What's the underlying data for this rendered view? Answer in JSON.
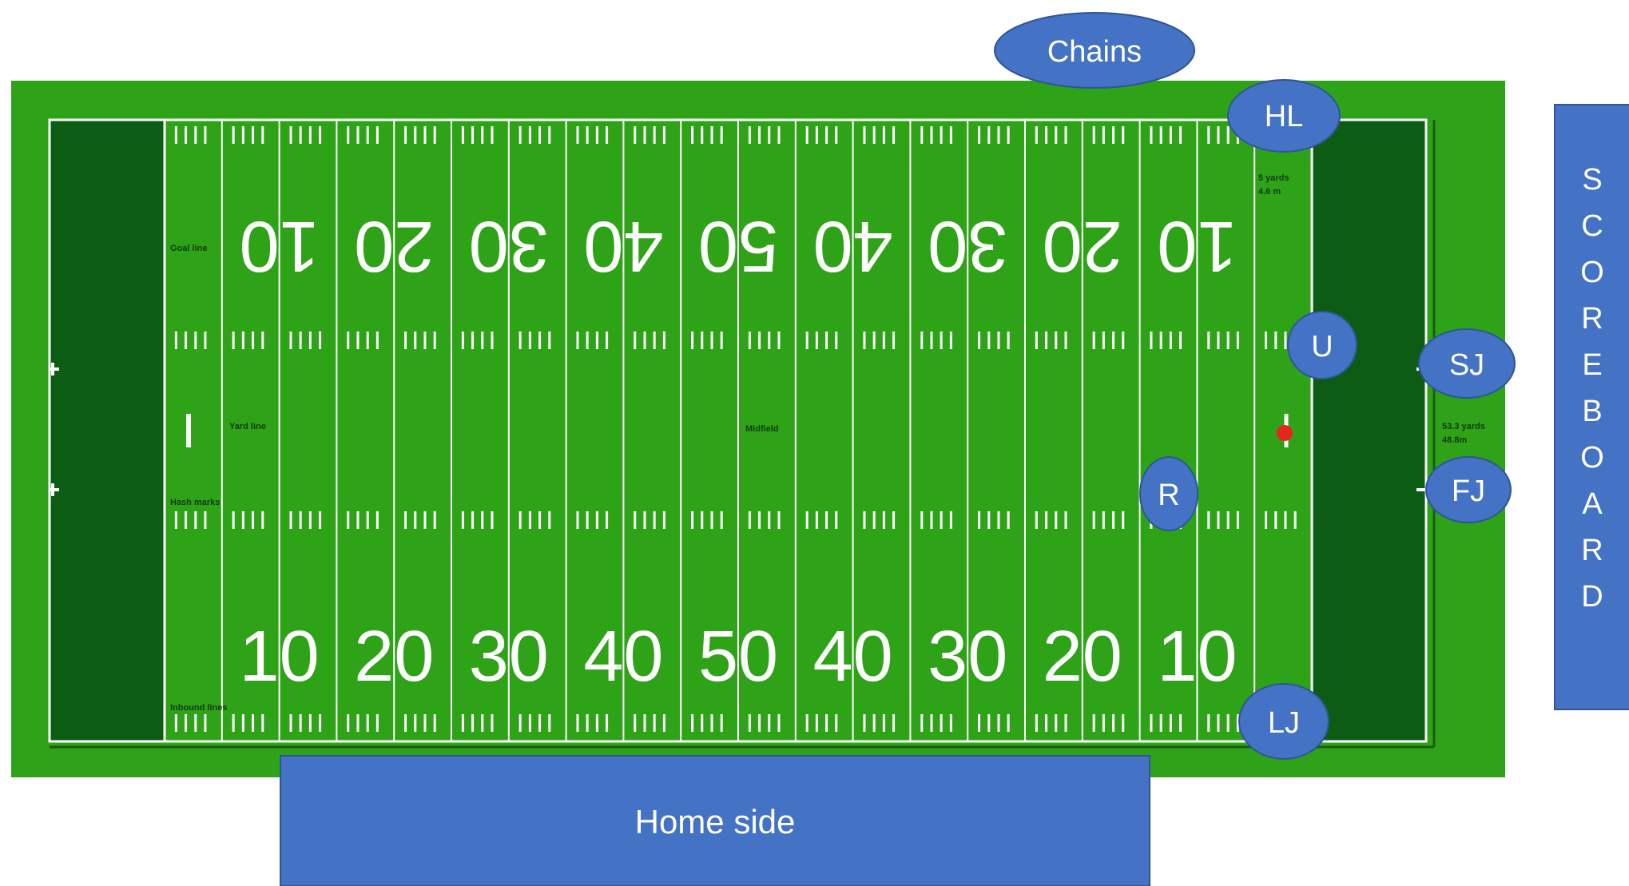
{
  "colors": {
    "field_green": "#2fa318",
    "endzone_green": "#0d5c14",
    "line_white": "#ffffff",
    "official_blue": "#4472c4",
    "official_border": "#2f5597",
    "ball_red": "#e8251d"
  },
  "field": {
    "yard_numbers_top": [
      "10",
      "20",
      "30",
      "40",
      "50",
      "40",
      "30",
      "20",
      "10"
    ],
    "yard_numbers_bottom": [
      "10",
      "20",
      "30",
      "40",
      "50",
      "40",
      "30",
      "20",
      "10"
    ],
    "labels": {
      "goal_line": "Goal line",
      "yard_line": "Yard line",
      "hash_marks": "Hash marks",
      "inbound_lines": "Inbound lines",
      "midfield": "Midfield",
      "five_yards_1": "5 yards",
      "five_yards_2": "4.6 m",
      "width_1": "53.3 yards",
      "width_2": "48.8m"
    }
  },
  "officials": {
    "chains": "Chains",
    "hl": "HL",
    "u": "U",
    "sj": "SJ",
    "fj": "FJ",
    "r": "R",
    "lj": "LJ"
  },
  "home_side": {
    "label": "Home side"
  },
  "scoreboard": {
    "letters": [
      "S",
      "C",
      "O",
      "R",
      "E",
      "B",
      "O",
      "A",
      "R",
      "D"
    ]
  }
}
